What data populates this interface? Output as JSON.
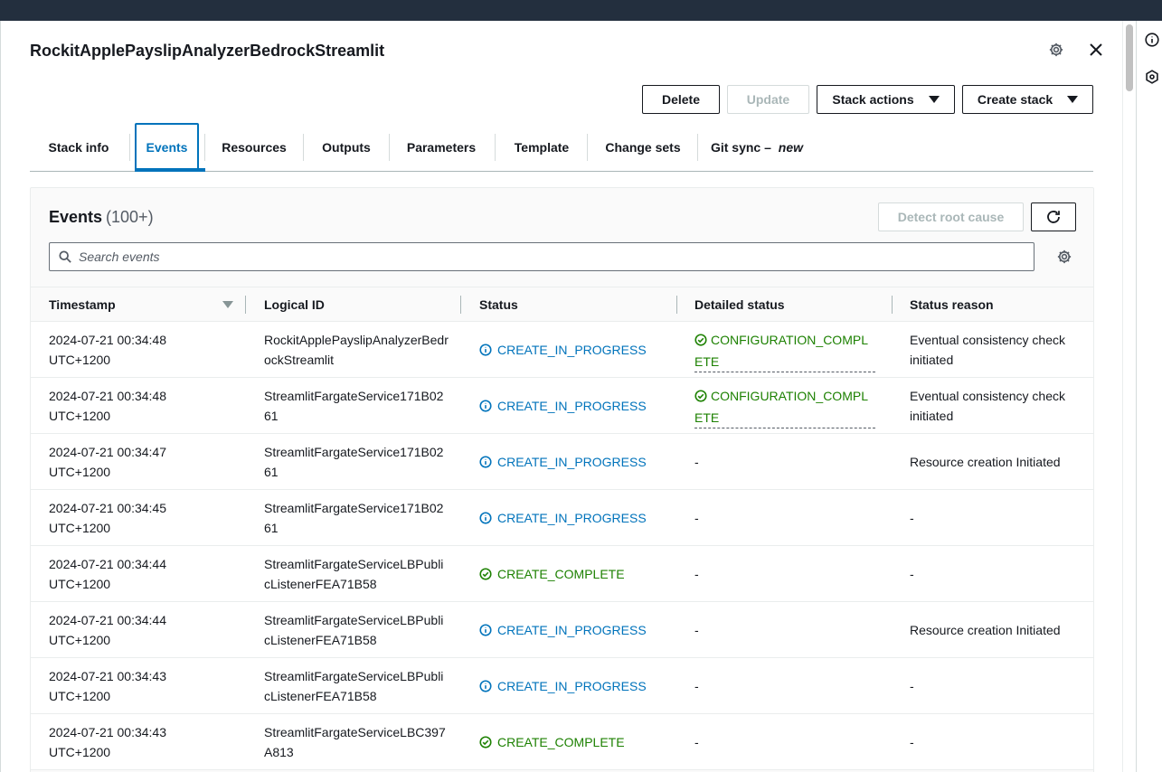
{
  "stack": {
    "title": "RockitApplePayslipAnalyzerBedrockStreamlit"
  },
  "header_icons": {
    "settings": "gear-icon",
    "close": "close-icon"
  },
  "actions": {
    "delete": "Delete",
    "update": "Update",
    "stack_actions": "Stack actions",
    "create_stack": "Create stack"
  },
  "tabs": [
    {
      "label": "Stack info"
    },
    {
      "label": "Events"
    },
    {
      "label": "Resources"
    },
    {
      "label": "Outputs"
    },
    {
      "label": "Parameters"
    },
    {
      "label": "Template"
    },
    {
      "label": "Change sets"
    },
    {
      "label": "Git sync – ",
      "badge": "new"
    }
  ],
  "active_tab": "Events",
  "events": {
    "title": "Events",
    "count": "(100+)",
    "detect_root_cause": "Detect root cause",
    "search_placeholder": "Search events",
    "columns": [
      "Timestamp",
      "Logical ID",
      "Status",
      "Detailed status",
      "Status reason"
    ],
    "rows": [
      {
        "ts1": "2024-07-21 00:34:48",
        "ts2": "UTC+1200",
        "logical_id": "RockitApplePayslipAnalyzerBedrockStreamlit",
        "status": "CREATE_IN_PROGRESS",
        "status_type": "info",
        "detailed": "CONFIGURATION_COMPLETE",
        "reason": "Eventual consistency check initiated"
      },
      {
        "ts1": "2024-07-21 00:34:48",
        "ts2": "UTC+1200",
        "logical_id": "StreamlitFargateService171B0261",
        "status": "CREATE_IN_PROGRESS",
        "status_type": "info",
        "detailed": "CONFIGURATION_COMPLETE",
        "reason": "Eventual consistency check initiated"
      },
      {
        "ts1": "2024-07-21 00:34:47",
        "ts2": "UTC+1200",
        "logical_id": "StreamlitFargateService171B0261",
        "status": "CREATE_IN_PROGRESS",
        "status_type": "info",
        "detailed": "-",
        "reason": "Resource creation Initiated"
      },
      {
        "ts1": "2024-07-21 00:34:45",
        "ts2": "UTC+1200",
        "logical_id": "StreamlitFargateService171B0261",
        "status": "CREATE_IN_PROGRESS",
        "status_type": "info",
        "detailed": "-",
        "reason": "-"
      },
      {
        "ts1": "2024-07-21 00:34:44",
        "ts2": "UTC+1200",
        "logical_id": "StreamlitFargateServiceLBPublicListenerFEA71B58",
        "status": "CREATE_COMPLETE",
        "status_type": "ok",
        "detailed": "-",
        "reason": "-"
      },
      {
        "ts1": "2024-07-21 00:34:44",
        "ts2": "UTC+1200",
        "logical_id": "StreamlitFargateServiceLBPublicListenerFEA71B58",
        "status": "CREATE_IN_PROGRESS",
        "status_type": "info",
        "detailed": "-",
        "reason": "Resource creation Initiated"
      },
      {
        "ts1": "2024-07-21 00:34:43",
        "ts2": "UTC+1200",
        "logical_id": "StreamlitFargateServiceLBPublicListenerFEA71B58",
        "status": "CREATE_IN_PROGRESS",
        "status_type": "info",
        "detailed": "-",
        "reason": "-"
      },
      {
        "ts1": "2024-07-21 00:34:43",
        "ts2": "UTC+1200",
        "logical_id": "StreamlitFargateServiceLBC397A813",
        "status": "CREATE_COMPLETE",
        "status_type": "ok",
        "detailed": "-",
        "reason": "-"
      }
    ]
  },
  "colors": {
    "accent": "#0073bb",
    "success": "#1d8102",
    "topbar": "#232f3e"
  }
}
